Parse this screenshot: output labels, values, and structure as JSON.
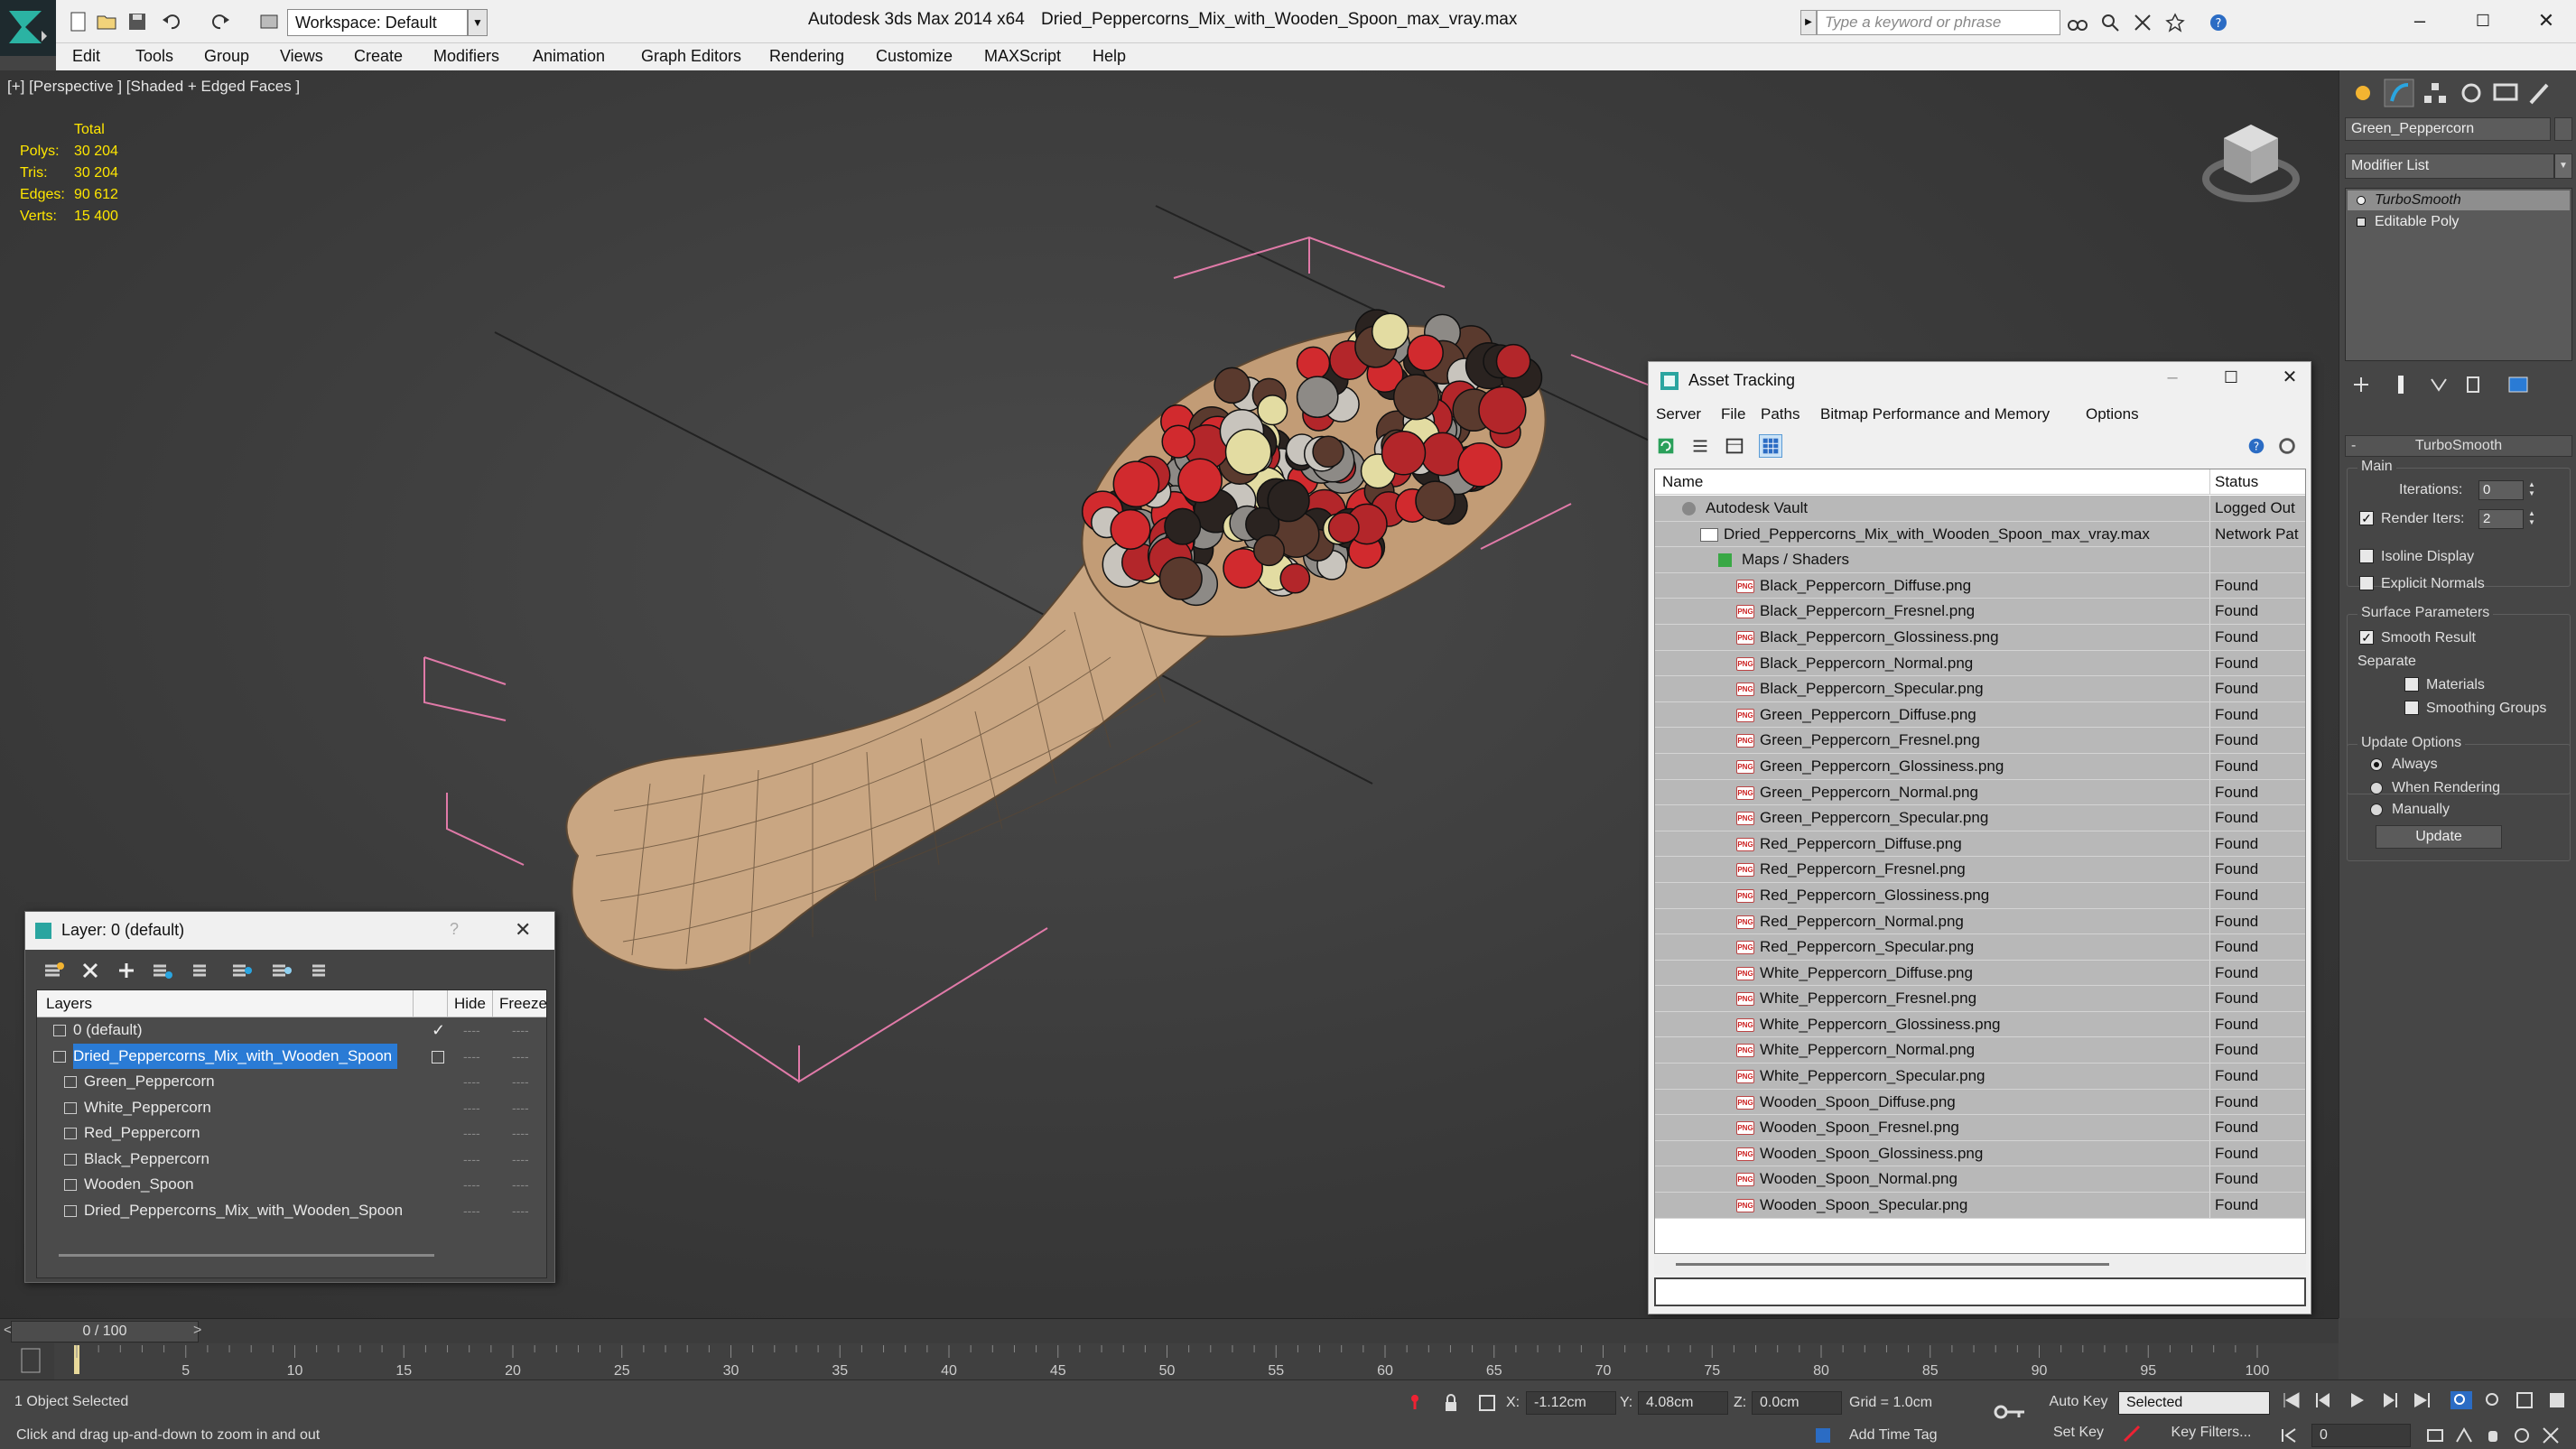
{
  "titlebar": {
    "workspace_label": "Workspace: Default",
    "app_title": "Autodesk 3ds Max  2014 x64",
    "file_title": "Dried_Peppercorns_Mix_with_Wooden_Spoon_max_vray.max",
    "search_placeholder": "Type a keyword or phrase"
  },
  "menubar": {
    "items": [
      "Edit",
      "Tools",
      "Group",
      "Views",
      "Create",
      "Modifiers",
      "Animation",
      "Graph Editors",
      "Rendering",
      "Customize",
      "MAXScript",
      "Help"
    ]
  },
  "viewport": {
    "label": "[+] [Perspective ] [Shaded + Edged Faces ]",
    "stats": {
      "header": "Total",
      "rows": [
        {
          "label": "Polys:",
          "value": "30 204"
        },
        {
          "label": "Tris:",
          "value": "30 204"
        },
        {
          "label": "Edges:",
          "value": "90 612"
        },
        {
          "label": "Verts:",
          "value": "15 400"
        }
      ]
    }
  },
  "command_panel": {
    "object_name": "Green_Peppercorn",
    "modifier_list": "Modifier List",
    "stack": [
      "TurboSmooth",
      "Editable Poly"
    ],
    "rollout_title": "TurboSmooth",
    "main_group": "Main",
    "iterations_label": "Iterations:",
    "iterations_value": "0",
    "render_iters_label": "Render Iters:",
    "render_iters_value": "2",
    "isoline_label": "Isoline Display",
    "explicit_normals_label": "Explicit Normals",
    "surface_group": "Surface Parameters",
    "smooth_result_label": "Smooth Result",
    "separate_label": "Separate",
    "materials_label": "Materials",
    "smoothing_groups_label": "Smoothing Groups",
    "update_group": "Update Options",
    "always_label": "Always",
    "when_rendering_label": "When Rendering",
    "manually_label": "Manually",
    "update_button": "Update"
  },
  "asset_tracking": {
    "title": "Asset Tracking",
    "menu": [
      "Server",
      "File",
      "Paths",
      "Bitmap Performance and Memory",
      "Options"
    ],
    "col_name": "Name",
    "col_status": "Status",
    "rows": [
      {
        "name": "Autodesk Vault",
        "status": "Logged Out",
        "indent": 1,
        "icon": "vault-icon"
      },
      {
        "name": "Dried_Peppercorns_Mix_with_Wooden_Spoon_max_vray.max",
        "status": "Network Pat",
        "indent": 2,
        "icon": "max-file-icon"
      },
      {
        "name": "Maps / Shaders",
        "status": "",
        "indent": 3,
        "icon": "maps-icon"
      },
      {
        "name": "Black_Peppercorn_Diffuse.png",
        "status": "Found",
        "indent": 4,
        "icon": "png-icon"
      },
      {
        "name": "Black_Peppercorn_Fresnel.png",
        "status": "Found",
        "indent": 4,
        "icon": "png-icon"
      },
      {
        "name": "Black_Peppercorn_Glossiness.png",
        "status": "Found",
        "indent": 4,
        "icon": "png-icon"
      },
      {
        "name": "Black_Peppercorn_Normal.png",
        "status": "Found",
        "indent": 4,
        "icon": "png-icon"
      },
      {
        "name": "Black_Peppercorn_Specular.png",
        "status": "Found",
        "indent": 4,
        "icon": "png-icon"
      },
      {
        "name": "Green_Peppercorn_Diffuse.png",
        "status": "Found",
        "indent": 4,
        "icon": "png-icon"
      },
      {
        "name": "Green_Peppercorn_Fresnel.png",
        "status": "Found",
        "indent": 4,
        "icon": "png-icon"
      },
      {
        "name": "Green_Peppercorn_Glossiness.png",
        "status": "Found",
        "indent": 4,
        "icon": "png-icon"
      },
      {
        "name": "Green_Peppercorn_Normal.png",
        "status": "Found",
        "indent": 4,
        "icon": "png-icon"
      },
      {
        "name": "Green_Peppercorn_Specular.png",
        "status": "Found",
        "indent": 4,
        "icon": "png-icon"
      },
      {
        "name": "Red_Peppercorn_Diffuse.png",
        "status": "Found",
        "indent": 4,
        "icon": "png-icon"
      },
      {
        "name": "Red_Peppercorn_Fresnel.png",
        "status": "Found",
        "indent": 4,
        "icon": "png-icon"
      },
      {
        "name": "Red_Peppercorn_Glossiness.png",
        "status": "Found",
        "indent": 4,
        "icon": "png-icon"
      },
      {
        "name": "Red_Peppercorn_Normal.png",
        "status": "Found",
        "indent": 4,
        "icon": "png-icon"
      },
      {
        "name": "Red_Peppercorn_Specular.png",
        "status": "Found",
        "indent": 4,
        "icon": "png-icon"
      },
      {
        "name": "White_Peppercorn_Diffuse.png",
        "status": "Found",
        "indent": 4,
        "icon": "png-icon"
      },
      {
        "name": "White_Peppercorn_Fresnel.png",
        "status": "Found",
        "indent": 4,
        "icon": "png-icon"
      },
      {
        "name": "White_Peppercorn_Glossiness.png",
        "status": "Found",
        "indent": 4,
        "icon": "png-icon"
      },
      {
        "name": "White_Peppercorn_Normal.png",
        "status": "Found",
        "indent": 4,
        "icon": "png-icon"
      },
      {
        "name": "White_Peppercorn_Specular.png",
        "status": "Found",
        "indent": 4,
        "icon": "png-icon"
      },
      {
        "name": "Wooden_Spoon_Diffuse.png",
        "status": "Found",
        "indent": 4,
        "icon": "png-icon"
      },
      {
        "name": "Wooden_Spoon_Fresnel.png",
        "status": "Found",
        "indent": 4,
        "icon": "png-icon"
      },
      {
        "name": "Wooden_Spoon_Glossiness.png",
        "status": "Found",
        "indent": 4,
        "icon": "png-icon"
      },
      {
        "name": "Wooden_Spoon_Normal.png",
        "status": "Found",
        "indent": 4,
        "icon": "png-icon"
      },
      {
        "name": "Wooden_Spoon_Specular.png",
        "status": "Found",
        "indent": 4,
        "icon": "png-icon"
      }
    ]
  },
  "layer_window": {
    "title": "Layer: 0 (default)",
    "help_glyph": "?",
    "col_layers": "Layers",
    "col_hide": "Hide",
    "col_freeze": "Freeze",
    "rows": [
      {
        "name": "0 (default)",
        "level": 1,
        "selected": false,
        "mark": "check"
      },
      {
        "name": "Dried_Peppercorns_Mix_with_Wooden_Spoon",
        "level": 1,
        "selected": true,
        "mark": "square"
      },
      {
        "name": "Green_Peppercorn",
        "level": 2,
        "selected": false,
        "mark": ""
      },
      {
        "name": "White_Peppercorn",
        "level": 2,
        "selected": false,
        "mark": ""
      },
      {
        "name": "Red_Peppercorn",
        "level": 2,
        "selected": false,
        "mark": ""
      },
      {
        "name": "Black_Peppercorn",
        "level": 2,
        "selected": false,
        "mark": ""
      },
      {
        "name": "Wooden_Spoon",
        "level": 2,
        "selected": false,
        "mark": ""
      },
      {
        "name": "Dried_Peppercorns_Mix_with_Wooden_Spoon",
        "level": 2,
        "selected": false,
        "mark": ""
      }
    ]
  },
  "timeline": {
    "frame_display": "0 / 100",
    "prev_glyph": "<",
    "next_glyph": ">",
    "ticks": [
      "5",
      "10",
      "15",
      "20",
      "25",
      "30",
      "35",
      "40",
      "45",
      "50",
      "55",
      "60",
      "65",
      "70",
      "75",
      "80",
      "85",
      "90",
      "95",
      "100"
    ]
  },
  "statusbar": {
    "selection_info": "1 Object Selected",
    "prompt": "Click and drag up-and-down to zoom in and out",
    "x_label": "X:",
    "x_value": "-1.12cm",
    "y_label": "Y:",
    "y_value": "4.08cm",
    "z_label": "Z:",
    "z_value": "0.0cm",
    "grid": "Grid = 1.0cm",
    "add_time_tag": "Add Time Tag",
    "auto_key": "Auto Key",
    "selected_dropdown": "Selected",
    "set_key": "Set Key",
    "key_filters": "Key Filters...",
    "current_frame": "0"
  },
  "colors": {
    "viewport_bg": "#3c3c3c",
    "stats_yellow": "#ffe600",
    "selection_blue": "#2a7bd5",
    "asset_row_gray": "#b8b8b8",
    "spoon_wood": "#c9a682",
    "gizmo_pink": "#e07aa8"
  }
}
